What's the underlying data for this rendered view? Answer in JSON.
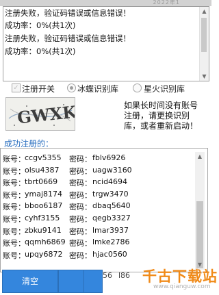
{
  "title_fragment": "2022年1",
  "log": {
    "lines": [
      "注册失败，验证码错误或信息错误！",
      "成功率：0%(共1次)",
      "注册失败，验证码错误或信息错误！",
      "成功率：0%(共1次)"
    ]
  },
  "options": {
    "register_switch": {
      "label": "注册开关",
      "checked": false
    },
    "radios": [
      {
        "label": "冰蝶识别库",
        "selected": true
      },
      {
        "label": "星火识别库",
        "selected": false
      }
    ]
  },
  "captcha": {
    "text": "GWXK"
  },
  "hint": "如果长时间没有账号注册，请更换识别库，或者重新启动！",
  "success": {
    "title": "成功注册的：",
    "account_label": "账号：",
    "password_label": "密码：",
    "rows": [
      {
        "account": "ccgv5355",
        "password": "fblv6926"
      },
      {
        "account": "olsu4387",
        "password": "uagw3160"
      },
      {
        "account": "tbrt0669",
        "password": "ncid4694"
      },
      {
        "account": "ymaj8174",
        "password": "trgw3470"
      },
      {
        "account": "bboo6187",
        "password": "dbaq5640"
      },
      {
        "account": "cyhf3155",
        "password": "qegb3327"
      },
      {
        "account": "zbku9141",
        "password": "lmar3937"
      },
      {
        "account": "qqmh6869",
        "password": "lmke2786"
      },
      {
        "account": "upqy6872",
        "password": "hjac0560"
      }
    ]
  },
  "buttons": {
    "clear": "清空",
    "second": "",
    "third": ""
  },
  "partial_under_buttons": [
    "56",
    "l86"
  ],
  "watermark": {
    "title": "千古下载站",
    "url": "www.qianguw.com"
  }
}
